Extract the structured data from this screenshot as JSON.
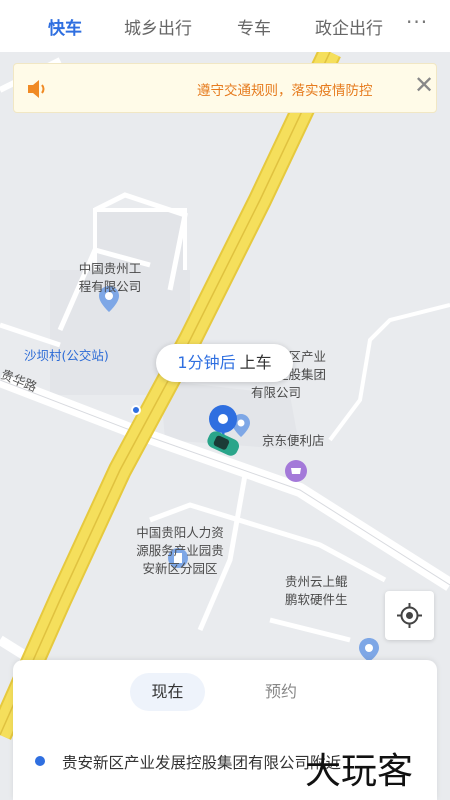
{
  "tabs": [
    {
      "label": "快车",
      "active": true
    },
    {
      "label": "城乡出行",
      "active": false
    },
    {
      "label": "专车",
      "active": false
    },
    {
      "label": "政企出行",
      "active": false
    }
  ],
  "more_label": "···",
  "notice": {
    "text": "遵守交通规则，落实疫情防控",
    "icon": "speaker-icon",
    "close_label": "✕"
  },
  "map_labels": {
    "guizhou_eng": "中国贵州工程有限公司",
    "guizhou_eng_l1": "中国贵州工",
    "guizhou_eng_l2": "程有限公司",
    "shaba_stop": "沙坝村(公交站)",
    "guian_group_l1": "贵安新区产业",
    "guian_group_l2": "发展控股集团",
    "guian_group_l3": "有限公司",
    "jd_store": "京东便利店",
    "hr_park_l1": "中国贵阳人力资",
    "hr_park_l2": "源服务产业园贵",
    "hr_park_l3": "安新区分园区",
    "yunshang_l1": "贵州云上鲲",
    "yunshang_l2": "鹏软硬件生",
    "road_guihua": "贵华路",
    "faded_stop": "沙坝村(公交站)"
  },
  "bubble": {
    "minutes": "1分钟后",
    "board": "上车"
  },
  "panel": {
    "now_label": "现在",
    "book_label": "预约",
    "pickup_address": "贵安新区产业发展控股集团有限公司附近"
  },
  "watermark": "大玩客",
  "colors": {
    "accent": "#2f6fe0",
    "notice_text": "#e67b1e",
    "road_yellow": "#f2d94e",
    "poi_blue": "#7ea7e6",
    "poi_purple": "#a479d9"
  }
}
